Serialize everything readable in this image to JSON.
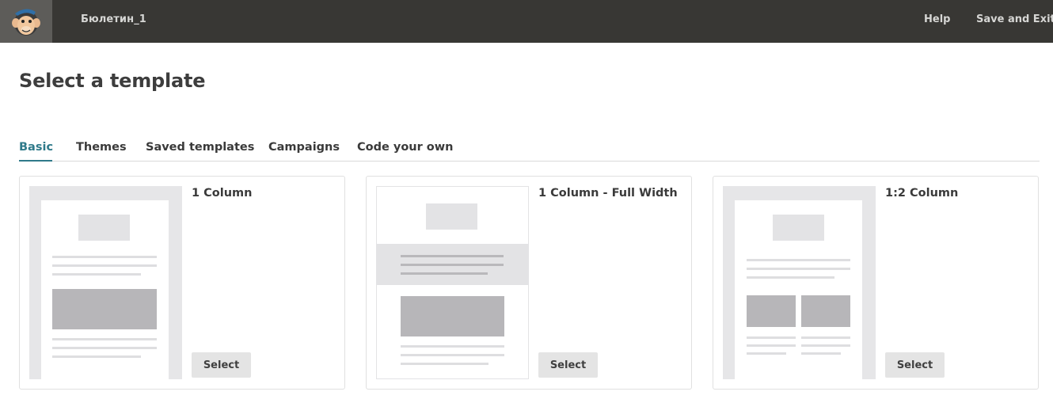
{
  "header": {
    "doc_title": "Бюлетин_1",
    "help_label": "Help",
    "save_exit_label": "Save and Exit"
  },
  "page": {
    "title": "Select a template"
  },
  "tabs": [
    {
      "label": "Basic",
      "active": true
    },
    {
      "label": "Themes",
      "active": false
    },
    {
      "label": "Saved templates",
      "active": false
    },
    {
      "label": "Campaigns",
      "active": false
    },
    {
      "label": "Code your own",
      "active": false
    }
  ],
  "templates": [
    {
      "title": "1 Column",
      "select_label": "Select"
    },
    {
      "title": "1 Column - Full Width",
      "select_label": "Select"
    },
    {
      "title": "1:2 Column",
      "select_label": "Select"
    }
  ],
  "colors": {
    "topbar": "#383734",
    "accent": "#2f7a8a"
  }
}
